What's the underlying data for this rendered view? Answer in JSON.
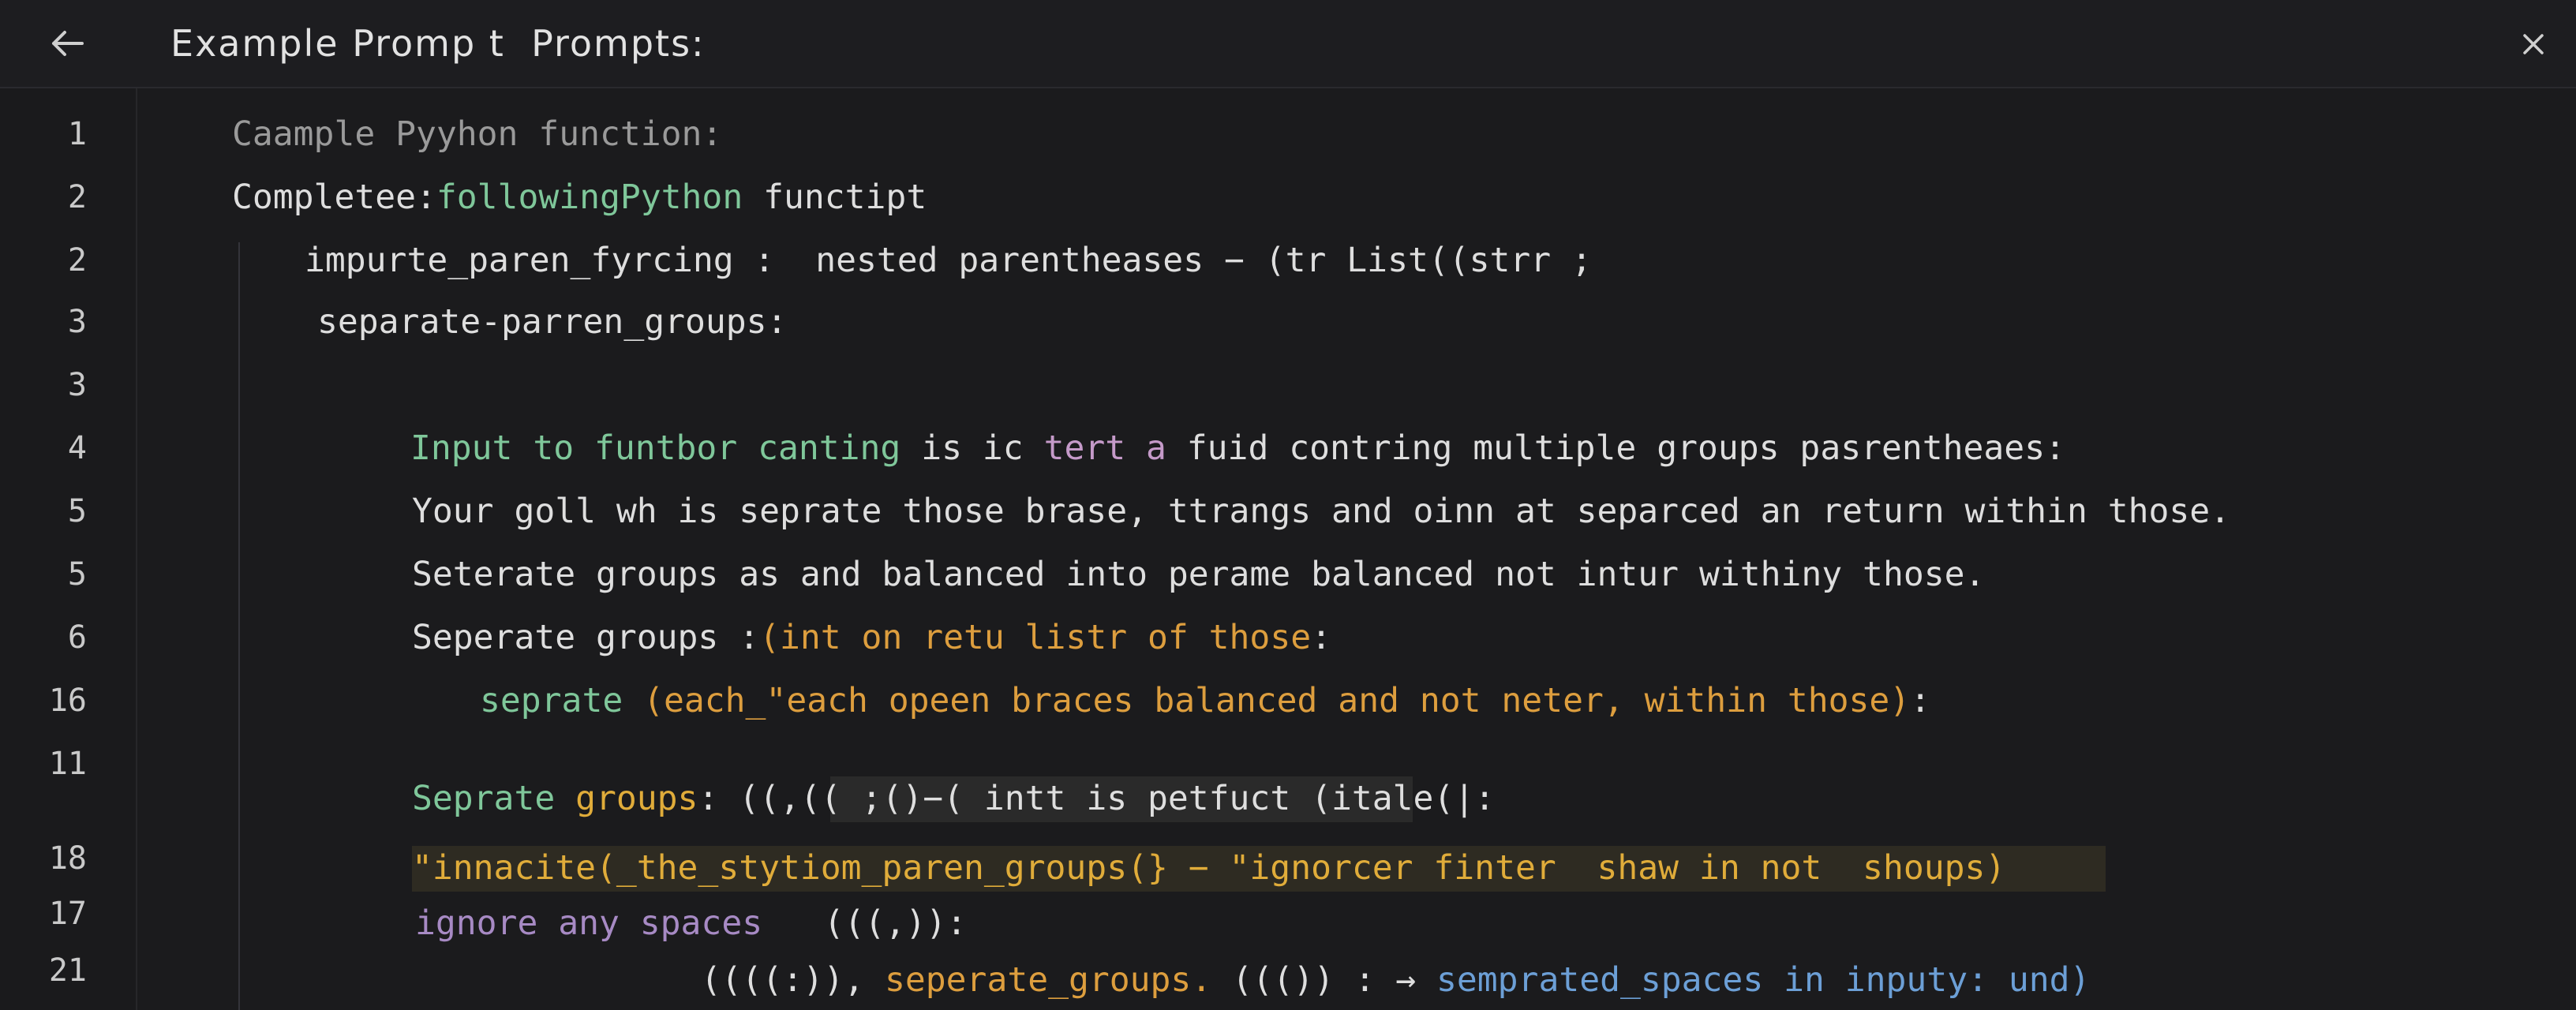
{
  "header": {
    "title": "Example Promp t  Prompts:"
  },
  "icons": {
    "back": "arrow-left-icon",
    "close": "close-icon"
  },
  "gutter": {
    "line_numbers": [
      "1",
      "2",
      "2",
      "3",
      "3",
      "4",
      "5",
      "5",
      "6",
      "16",
      "11",
      "18",
      "17",
      "21"
    ]
  },
  "code": {
    "lines": [
      [
        {
          "t": "Caample Pyyhon function:",
          "c": "dim"
        }
      ],
      [
        {
          "t": "Completee:",
          "c": "white"
        },
        {
          "t": "followingPython",
          "c": "green"
        },
        {
          "t": " functipt",
          "c": "white"
        }
      ],
      [
        {
          "t": "impurte_paren_fyrcing :  nested parentheases − (tr List((strr ;",
          "c": "white"
        }
      ],
      [
        {
          "t": "separate-parren_groups:",
          "c": "white"
        }
      ],
      [],
      [
        {
          "t": "Input to funtbor canting ",
          "c": "green"
        },
        {
          "t": "is ic ",
          "c": "white"
        },
        {
          "t": "tert a ",
          "c": "pink"
        },
        {
          "t": "fuid contring multiple groups pasrentheaes:",
          "c": "white"
        }
      ],
      [
        {
          "t": "Your goll wh is seprate those brase, ttrangs and oinn at separced an return within those.",
          "c": "white"
        }
      ],
      [
        {
          "t": "Seterate groups as and balanced into perame balanced not intur withiny those.",
          "c": "white"
        }
      ],
      [
        {
          "t": "Seperate groups :",
          "c": "white"
        },
        {
          "t": "(int on retu listr of those",
          "c": "orange"
        },
        {
          "t": ":",
          "c": "white"
        }
      ],
      [
        {
          "t": "seprate ",
          "c": "green"
        },
        {
          "t": "(each_\"each opeen braces balanced and not neter, within those)",
          "c": "orange"
        },
        {
          "t": ":",
          "c": "white"
        }
      ],
      [],
      [
        {
          "t": "Seprate ",
          "c": "green"
        },
        {
          "t": "groups",
          "c": "gold"
        },
        {
          "t": ": ((,(( ;()−( intt is petfuct (itale(|:",
          "c": "white"
        }
      ],
      [
        {
          "t": "\"innacite(_the_stytiom_paren_groups(} − \"ignorcer finter  shaw in not  shoups)",
          "c": "gold"
        }
      ],
      [
        {
          "t": "ignore any spaces ",
          "c": "purple"
        },
        {
          "t": "  (((,)):",
          "c": "white"
        }
      ],
      [
        {
          "t": "((((:)), ",
          "c": "white"
        },
        {
          "t": "seperate_groups. ",
          "c": "orange"
        },
        {
          "t": "((()) : → ",
          "c": "white"
        },
        {
          "t": "semprated_spaces in inputy: und)",
          "c": "blue"
        }
      ]
    ]
  },
  "colors": {
    "background": "#1b1b1d",
    "green": "#7fc79a",
    "orange": "#dd9e3e",
    "gold": "#e0ac3a",
    "purple": "#a78ac4",
    "blue": "#6c9fd6",
    "pink": "#c59ac9"
  }
}
